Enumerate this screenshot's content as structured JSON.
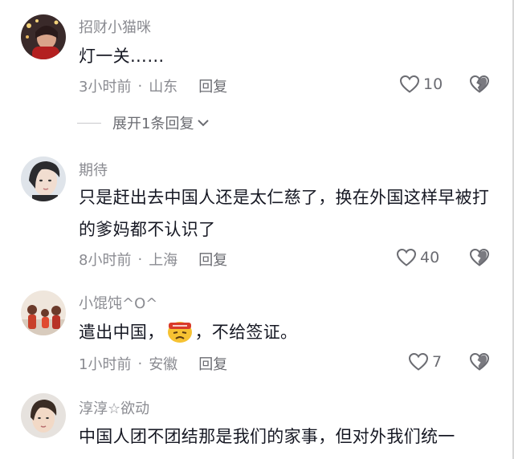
{
  "comments": [
    {
      "username": "招财小猫咪",
      "content": "灯一关……",
      "time": "3小时前",
      "location": "山东",
      "reply_label": "回复",
      "likes": "10",
      "expand_label": "展开1条回复"
    },
    {
      "username": "期待",
      "content": "只是赶出去中国人还是太仁慈了，换在外国这样早被打的爹妈都不认识了",
      "time": "8小时前",
      "location": "上海",
      "reply_label": "回复",
      "likes": "40"
    },
    {
      "username": "小馄饨^O^",
      "content_before": "遣出中国，",
      "content_after": "，不给签证。",
      "emoji": "angry-face-emoji",
      "time": "1小时前",
      "location": "安徽",
      "reply_label": "回复",
      "likes": "7"
    },
    {
      "username": "淳淳☆欲动",
      "content": "中国人团不团结那是我们的家事，但对外我们统一",
      "time": "",
      "location": "",
      "reply_label": "",
      "likes": ""
    }
  ],
  "icons": {
    "like": "heart-outline-icon",
    "dislike": "broken-heart-icon",
    "expand": "chevron-down-icon"
  },
  "colors": {
    "text": "#161823",
    "secondary": "#8a8b91",
    "icon": "#6b6c72"
  }
}
